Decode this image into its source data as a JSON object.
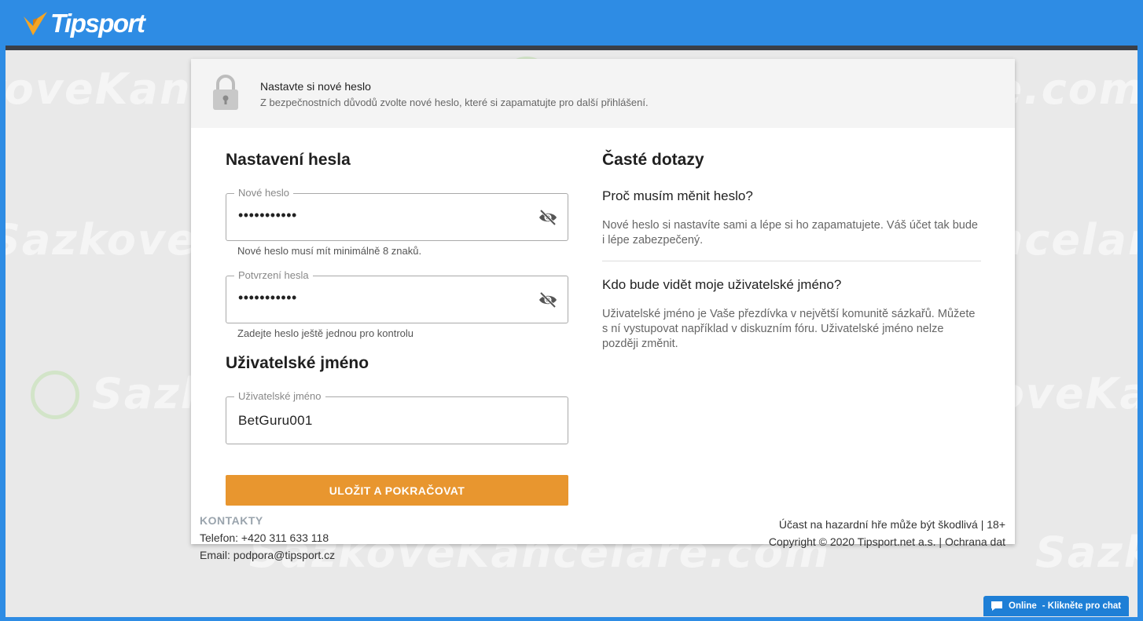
{
  "brand": {
    "name": "Tipsport",
    "logo_accent": "#f5a524"
  },
  "colors": {
    "topbar": "#2e8ce4",
    "button": "#e8962f",
    "chat": "#1e7fd6"
  },
  "watermark_text": "SazkoveKancelare.com",
  "header": {
    "title": "Nastavte si nové heslo",
    "subtitle": "Z bezpečnostních důvodů zvolte nové heslo, které si zapamatujte pro další přihlášení."
  },
  "password_section": {
    "title": "Nastavení hesla",
    "new_password": {
      "label": "Nové heslo",
      "value": "•••••••••••",
      "help": "Nové heslo musí mít minimálně 8 znaků."
    },
    "confirm_password": {
      "label": "Potvrzení hesla",
      "value": "•••••••••••",
      "help": "Zadejte heslo ještě jednou pro kontrolu"
    }
  },
  "username_section": {
    "title": "Uživatelské jméno",
    "username": {
      "label": "Uživatelské jméno",
      "value": "BetGuru001"
    }
  },
  "submit_label": "ULOŽIT A POKRAČOVAT",
  "faq": {
    "title": "Časté dotazy",
    "items": [
      {
        "question": "Proč musím měnit heslo?",
        "answer": "Nové heslo si nastavíte sami a lépe si ho zapamatujete. Váš účet tak bude i lépe zabezpečený."
      },
      {
        "question": "Kdo bude vidět moje uživatelské jméno?",
        "answer": "Uživatelské jméno je Vaše přezdívka v největší komunitě sázkařů. Můžete s ní vystupovat například v diskuzním fóru. Uživatelské jméno nelze později změnit."
      }
    ]
  },
  "footer": {
    "contacts_heading": "KONTAKTY",
    "phone": "Telefon: +420 311 633 118",
    "email": "Email: podpora@tipsport.cz",
    "warning": "Účast na hazardní hře může být škodlivá | 18+",
    "copyright": "Copyright © 2020 Tipsport.net a.s. | Ochrana dat"
  },
  "chat": {
    "status": "Online",
    "label": "- Klikněte pro chat"
  }
}
